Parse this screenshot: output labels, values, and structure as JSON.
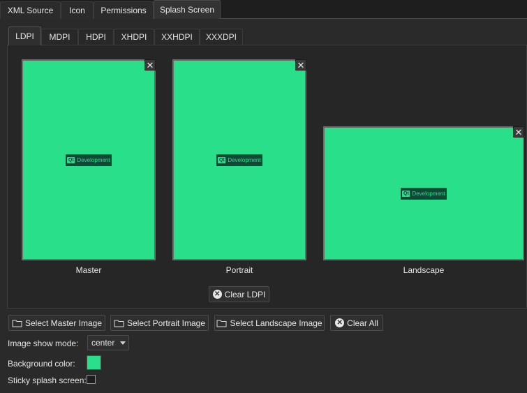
{
  "top_tabs": [
    "XML Source",
    "Icon",
    "Permissions",
    "Splash Screen"
  ],
  "dpi_tabs": [
    "LDPI",
    "MDPI",
    "HDPI",
    "XHDPI",
    "XXHDPI",
    "XXXDPI"
  ],
  "images": {
    "master_label": "Master",
    "portrait_label": "Portrait",
    "landscape_label": "Landscape",
    "logo_text": "Development",
    "logo_mark": "Qt",
    "close_glyph": "✕"
  },
  "clear_dpi_label": "Clear LDPI",
  "buttons": {
    "select_master": "Select Master Image",
    "select_portrait": "Select Portrait Image",
    "select_landscape": "Select Landscape Image",
    "clear_all": "Clear All"
  },
  "form": {
    "show_mode_label": "Image show mode:",
    "show_mode_value": "center",
    "bg_color_label": "Background color:",
    "bg_color_value": "#2adf8a",
    "sticky_label": "Sticky splash screen:",
    "sticky_checked": false
  },
  "colors": {
    "splash_green": "#2adf8a",
    "logo_dark": "#0e4a35"
  },
  "icons": {
    "folder": "folder-icon",
    "clear": "circle-x-icon",
    "close": "close-icon",
    "dropdown": "chevron-down-icon"
  }
}
